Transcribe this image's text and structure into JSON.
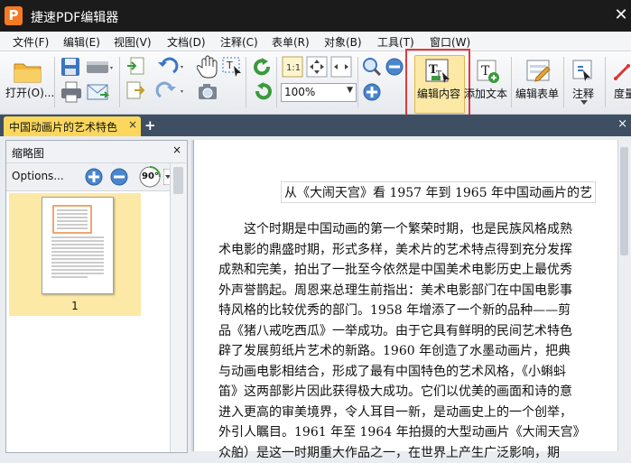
{
  "app": {
    "logo": "P",
    "title": "捷速PDF编辑器",
    "close_glyph": "✕"
  },
  "menu": [
    "文件(F)",
    "编辑(E)",
    "视图(V)",
    "文档(D)",
    "注释(C)",
    "表单(R)",
    "对象(B)",
    "工具(T)",
    "窗口(W)"
  ],
  "toolbar": {
    "open_label": "打开(O)...",
    "zoom_value": "100%",
    "edit_content_label": "编辑内容",
    "add_text_label": "添加文本",
    "edit_form_label": "编辑表单",
    "annotate_label": "注释",
    "measure_label": "度量",
    "rotate_label": "90°"
  },
  "tabs": {
    "active": "中国动画片的艺术特色",
    "close_glyph": "×",
    "add_glyph": "+",
    "close_all_glyph": "×"
  },
  "panel": {
    "title": "缩略图",
    "close_glyph": "×",
    "options_label": "Options...",
    "page_number": "1"
  },
  "document": {
    "title": "从《大闹天宫》看 1957 年到 1965 年中国动画片的艺",
    "lines": [
      "这个时期是中国动画的第一个繁荣时期，也是民族风格成熟",
      "术电影的鼎盛时期，形式多样，美术片的艺术特点得到充分发挥",
      "成熟和完美，拍出了一批至今依然是中国美术电影历史上最优秀",
      "外声誉鹊起。周恩来总理生前指出：美术电影部门在中国电影事",
      "特风格的比较优秀的部门。1958 年增添了一个新的品种——剪",
      "品《猪八戒吃西瓜》一举成功。由于它具有鲜明的民间艺术特色",
      "辟了发展剪纸片艺术的新路。1960 年创造了水墨动画片，把典",
      "与动画电影相结合，形成了最有中国特色的艺术风格，《小蝌蚪",
      "笛》这两部影片因此获得极大成功。它们以优美的画面和诗的意",
      "进入更高的审美境界，令人耳目一新，是动画史上的一个创举，",
      "外引人瞩目。1961 年至 1964 年拍摄的大型动画片《大闹天宫》",
      "众舶）是这一时期重大作品之一，在世界上产生广泛影响，期"
    ]
  },
  "colors": {
    "accent": "#fbd75c",
    "highlight_border": "#e23a3a",
    "tabbar": "#3e4f63",
    "titlebar": "#1b1b1b"
  }
}
